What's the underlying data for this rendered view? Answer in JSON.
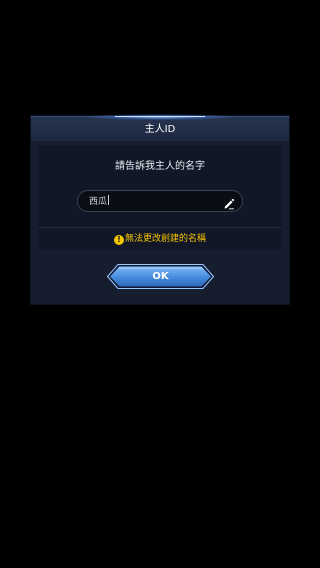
{
  "dialog": {
    "title": "主人ID",
    "prompt": "請告訴我主人的名字",
    "name_input": {
      "value": "西瓜",
      "edit_icon": "pencil-icon"
    },
    "warning": {
      "icon": "exclamation-icon",
      "icon_glyph": "!",
      "text": "無法更改創建的名稱"
    },
    "confirm_label": "OK"
  },
  "colors": {
    "accent_blue": "#4a8fe0",
    "warning_yellow": "#f5c400",
    "dialog_bg": "#161d2e",
    "background": "#000000"
  }
}
